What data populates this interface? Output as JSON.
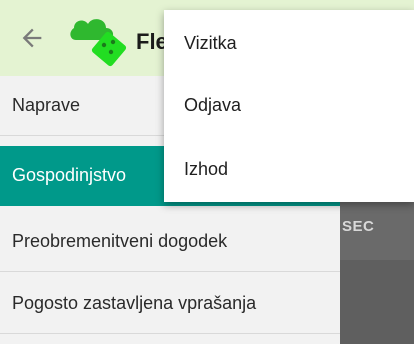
{
  "header": {
    "title": "Fle",
    "back_icon": "arrow-left-icon",
    "logo_icon": "cloud-box-logo",
    "bg_color": "#e4f3d2"
  },
  "drawer": {
    "items": [
      {
        "label": "Naprave",
        "active": false
      },
      {
        "label": "Gospodinjstvo",
        "active": true
      },
      {
        "label": "Preobremenitveni dogodek",
        "active": false
      },
      {
        "label": "Pogosto zastavljena vprašanja",
        "active": false
      }
    ],
    "active_color": "#00998a"
  },
  "background": {
    "partial_label": "SEC"
  },
  "menu": {
    "items": [
      {
        "label": "Vizitka"
      },
      {
        "label": "Odjava"
      },
      {
        "label": "Izhod"
      }
    ]
  }
}
